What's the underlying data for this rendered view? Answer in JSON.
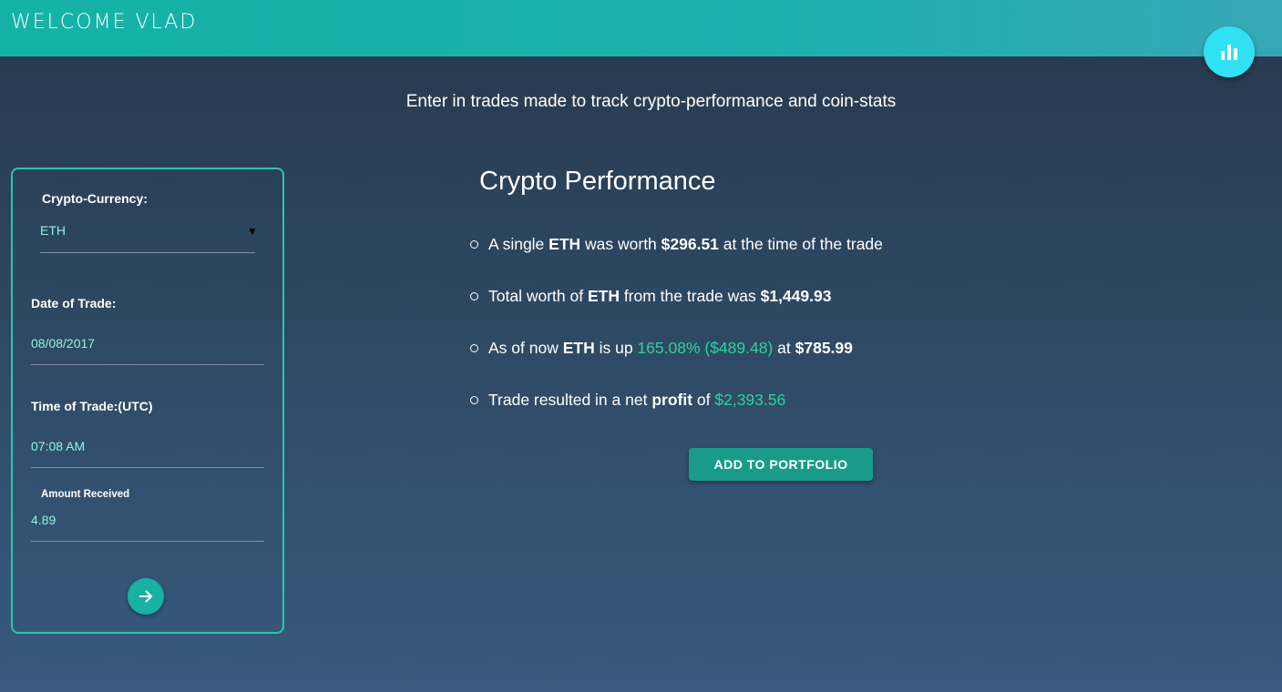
{
  "header": {
    "title": "WELCOME VLAD",
    "fab_icon": "bar-chart-icon"
  },
  "subtitle": "Enter in trades made to track crypto-performance and coin-stats",
  "form": {
    "currency_label": "Crypto-Currency:",
    "currency_value": "ETH",
    "date_label": "Date of Trade:",
    "date_value": "08/08/2017",
    "time_label": "Time of Trade:(UTC)",
    "time_value": "07:08 AM",
    "amount_label": "Amount Received",
    "amount_value": "4.89",
    "submit_icon": "arrow-right-icon"
  },
  "performance": {
    "title": "Crypto Performance",
    "line1": {
      "pre": "A single ",
      "coin": "ETH",
      "mid": " was worth ",
      "price": "$296.51",
      "post": " at the time of the trade"
    },
    "line2": {
      "pre": "Total worth of ",
      "coin": "ETH",
      "mid": " from the trade was ",
      "total": "$1,449.93"
    },
    "line3": {
      "pre": "As of now ",
      "coin": "ETH",
      "mid": " is up ",
      "change": "165.08% ($489.48)",
      "at": " at ",
      "price": "$785.99"
    },
    "line4": {
      "pre": "Trade resulted in a net ",
      "kind": "profit",
      "mid": " of ",
      "amount": "$2,393.56"
    },
    "add_button": "ADD TO PORTFOLIO"
  },
  "colors": {
    "accent": "#1db1ae",
    "positive": "#2ed39a",
    "input_text": "#8ff5de",
    "fab": "#2fe1f2"
  }
}
